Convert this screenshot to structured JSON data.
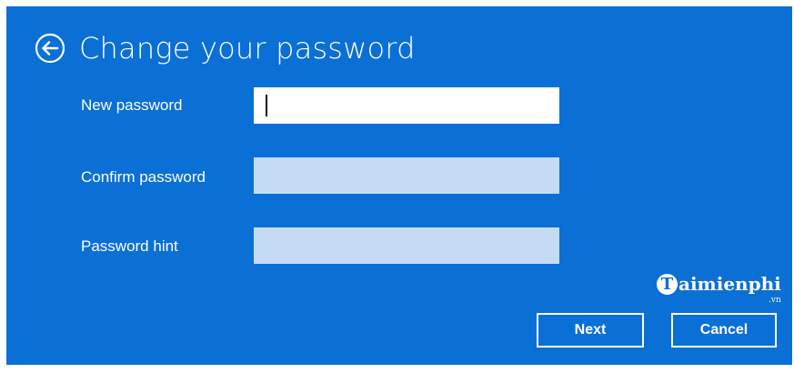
{
  "header": {
    "back_icon": "arrow-left-circle-icon",
    "title": "Change your password"
  },
  "form": {
    "new_password": {
      "label": "New password",
      "value": ""
    },
    "confirm_password": {
      "label": "Confirm password",
      "value": ""
    },
    "password_hint": {
      "label": "Password hint",
      "value": ""
    }
  },
  "buttons": {
    "next": "Next",
    "cancel": "Cancel"
  },
  "watermark": {
    "logo_letter": "T",
    "text": "aimienphi",
    "suffix": ".vn"
  },
  "colors": {
    "background": "#0a70d6",
    "inactive_field": "#c4dbf3",
    "text": "#ffffff"
  }
}
